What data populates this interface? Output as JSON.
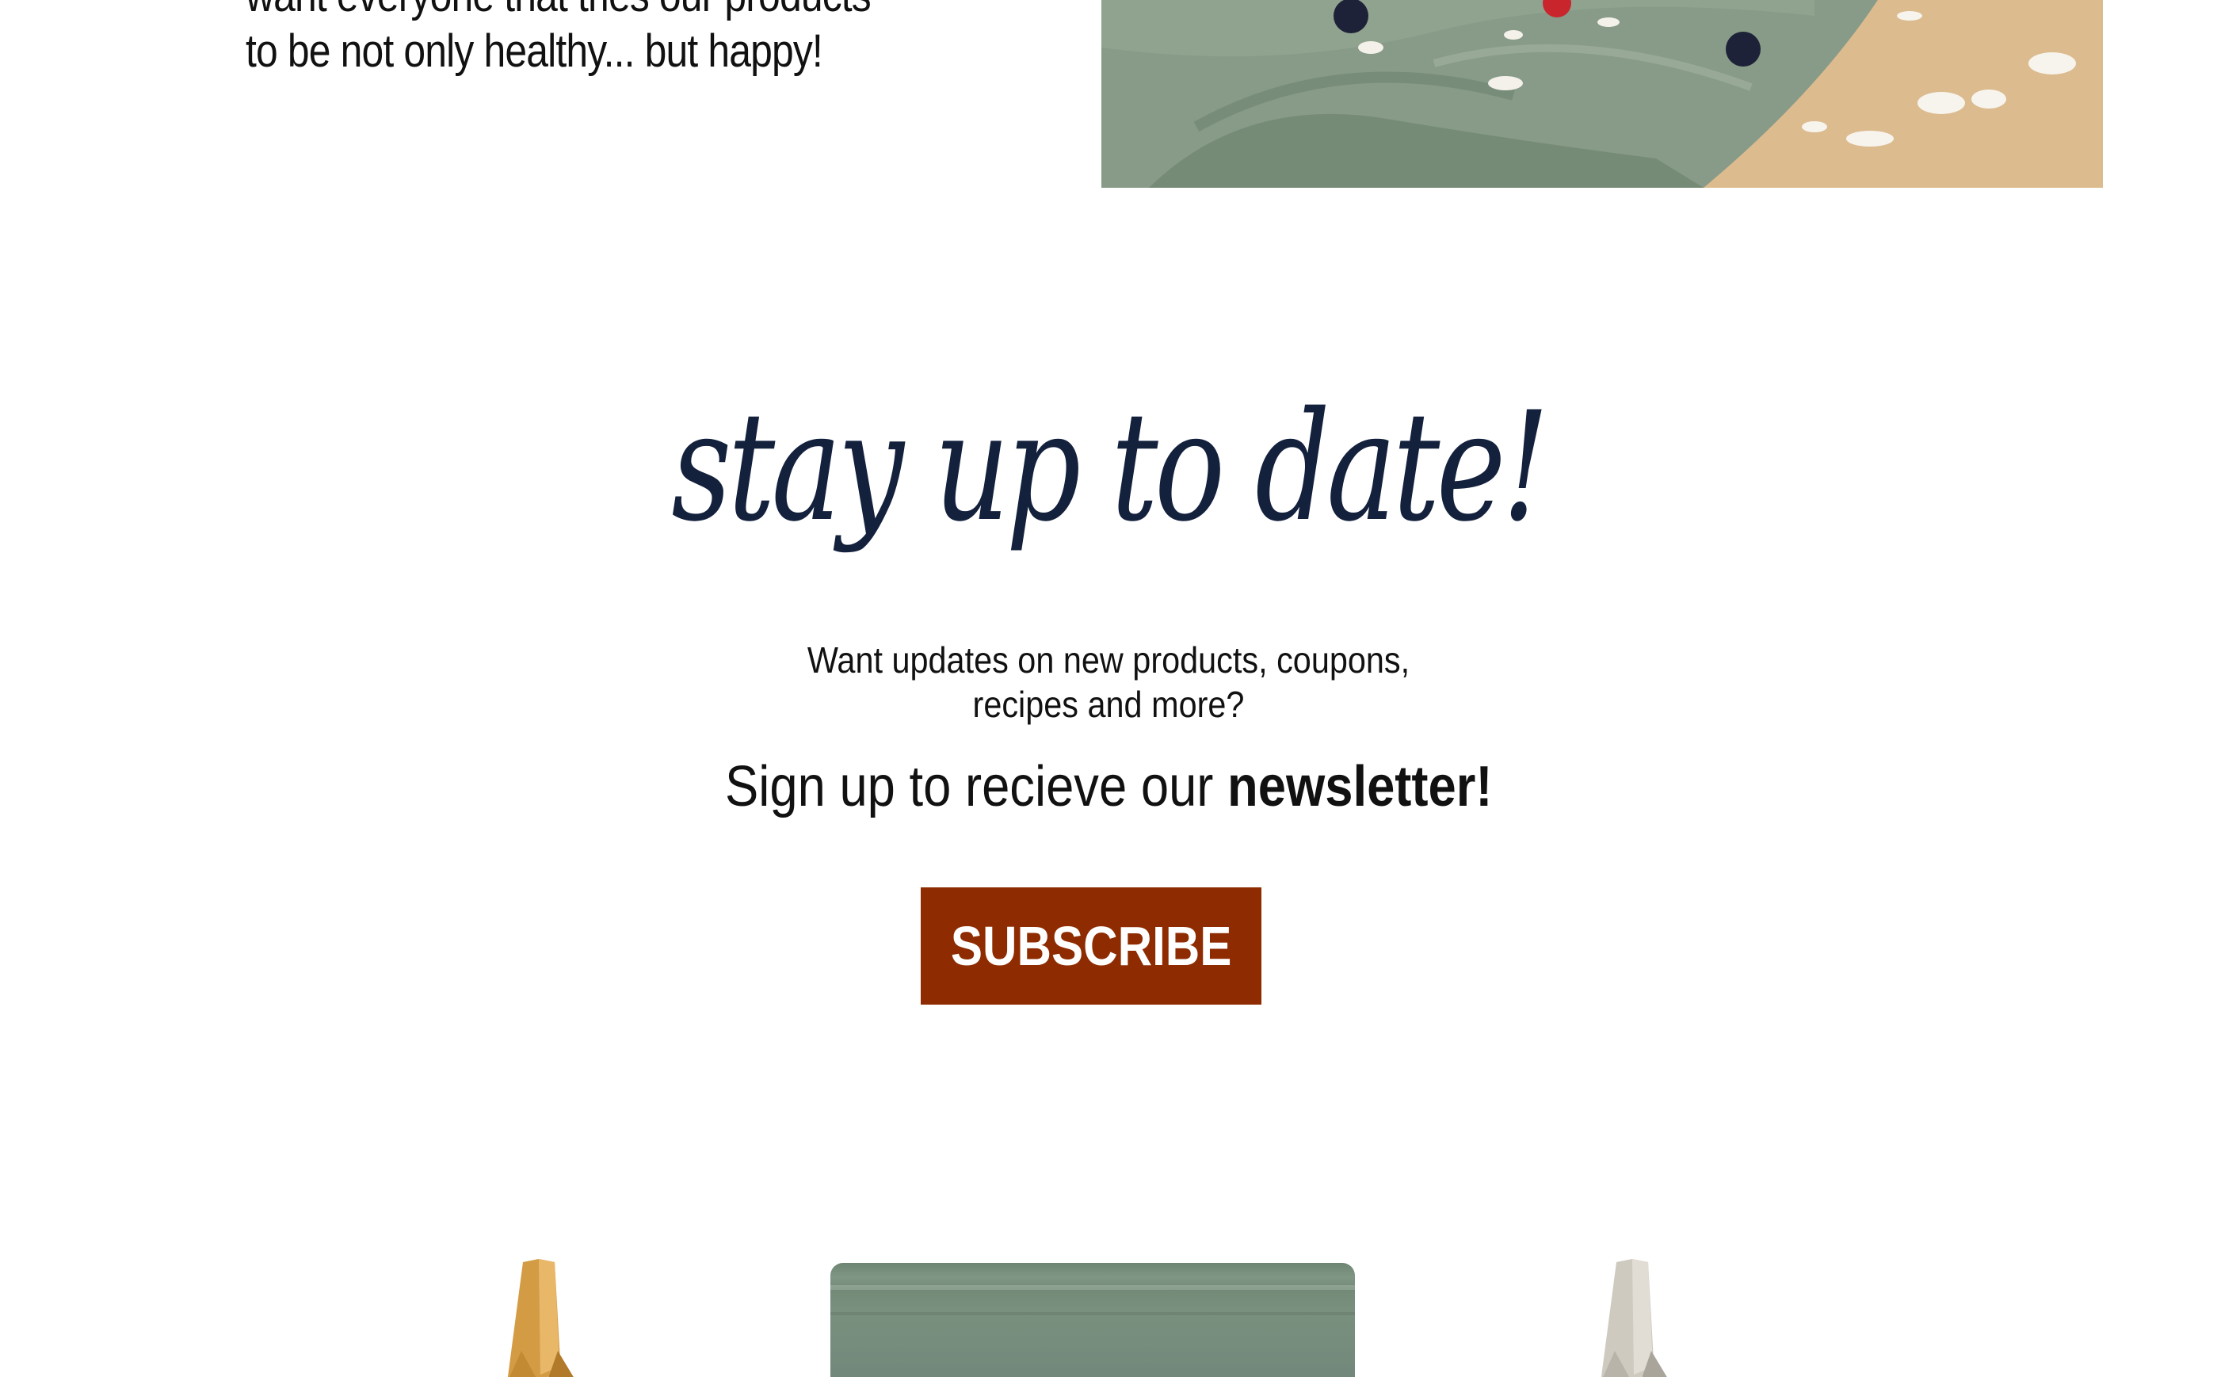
{
  "about": {
    "lines": [
      "want everyone that tries our products",
      "to be not only healthy... but happy!"
    ],
    "image": "food-photo-green-linen-berries"
  },
  "newsletter": {
    "title": "stay up to date!",
    "description_lines": [
      "Want updates on new products, coupons,",
      "recipes and more?"
    ],
    "cta_prefix": "Sign up to recieve our ",
    "cta_bold": "newsletter!",
    "subscribe_label": "SUBSCRIBE"
  },
  "products": [
    {
      "name": "product-package-tan",
      "color": "#c9923a"
    },
    {
      "name": "product-package-green",
      "color": "#71877a"
    },
    {
      "name": "product-package-grey",
      "color": "#c8c3b8"
    }
  ],
  "colors": {
    "title": "#14213d",
    "button": "#8e2b00",
    "button_text": "#ffffff",
    "body_text": "#111111"
  }
}
